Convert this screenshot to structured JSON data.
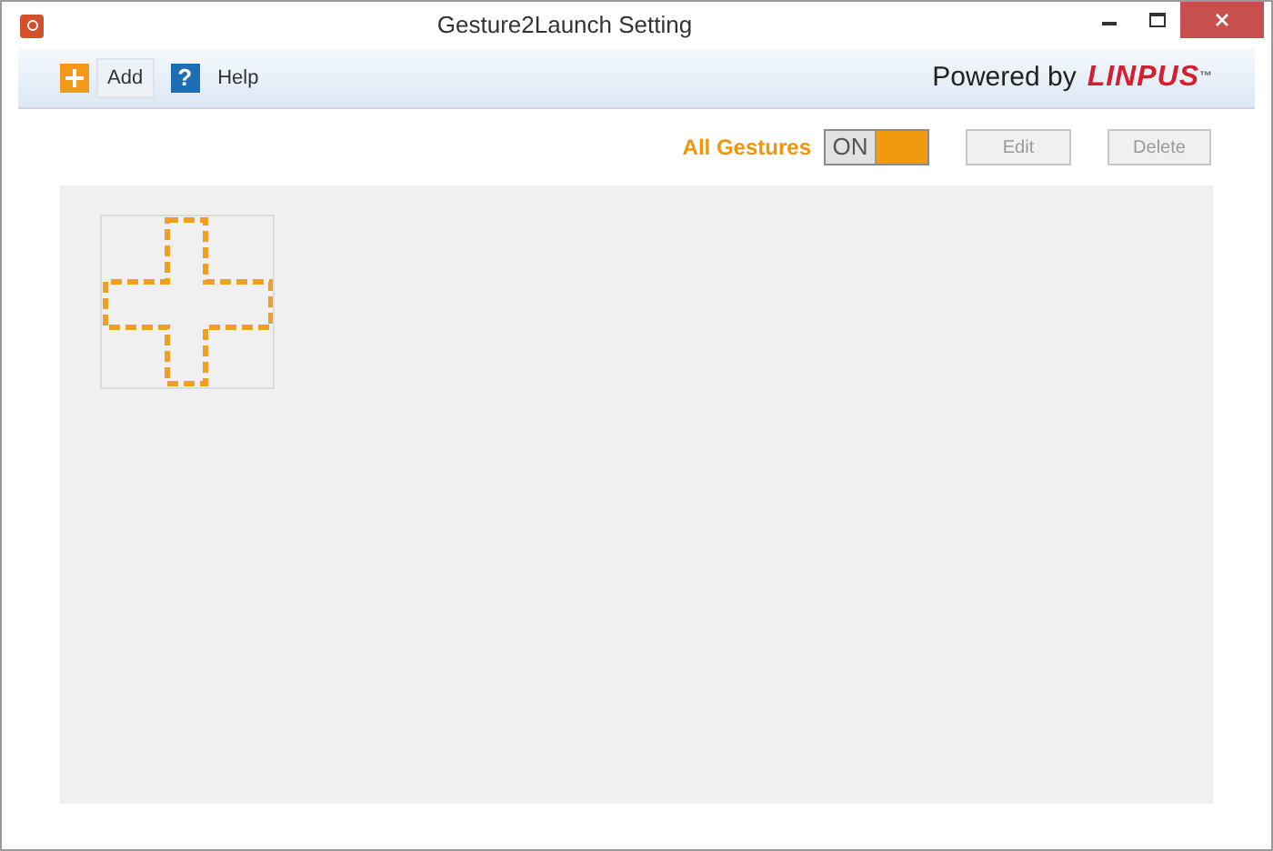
{
  "window": {
    "title": "Gesture2Launch Setting"
  },
  "toolbar": {
    "add": "Add",
    "help_icon": "?",
    "help": "Help",
    "powered_by": "Powered by",
    "brand": "LINPUS",
    "trademark": "™"
  },
  "gesture_switch": {
    "label": "All Gestures",
    "on": true,
    "text": "ON"
  },
  "buttons": [
    {
      "label": "Edit",
      "disabled": true
    },
    {
      "label": "Delete",
      "disabled": true
    }
  ]
}
